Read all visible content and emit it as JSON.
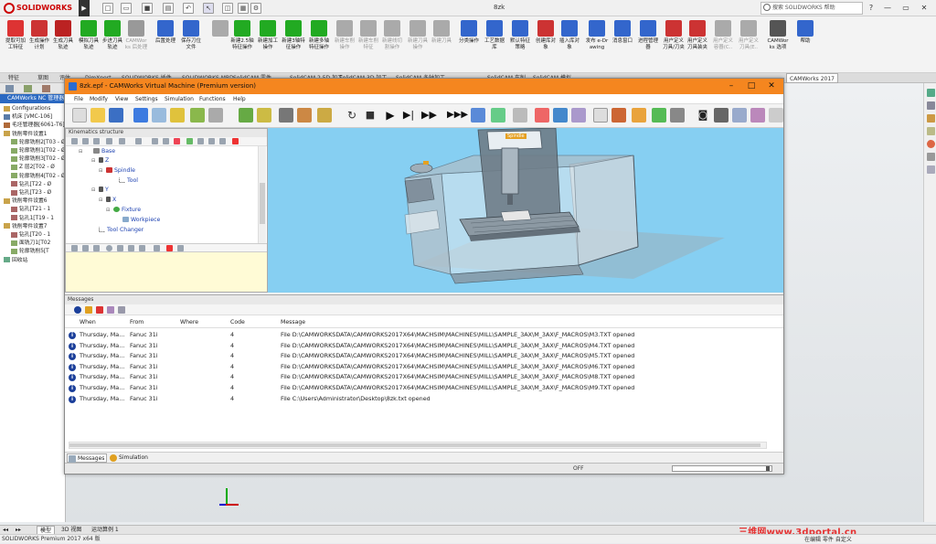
{
  "sw": {
    "logo": "SOLIDWORKS",
    "doc_name": "8zk",
    "search_placeholder": "搜索 SOLIDWORKS 帮助",
    "window_buttons": [
      "?",
      "—",
      "▭",
      "✕"
    ],
    "command_items": [
      {
        "label": "提取可加工特征",
        "color": "#d33"
      },
      {
        "label": "生成操作计划",
        "color": "#c33"
      },
      {
        "label": "生成刀具轨迹",
        "color": "#b22"
      },
      {
        "label": "模拟刀具轨迹",
        "color": "#2a2"
      },
      {
        "label": "步进刀具轨迹",
        "color": "#2a2"
      },
      {
        "label": "CAMWorks 后处理",
        "color": "#999",
        "disabled": true
      },
      {
        "label": "后置处理",
        "color": "#36c"
      },
      {
        "label": "保存刀位文件",
        "color": "#36c"
      },
      {
        "label": "",
        "color": "#aaa",
        "disabled": true
      },
      {
        "label": "新建2.5轴特征操作",
        "color": "#2a2"
      },
      {
        "label": "新建加工操作",
        "color": "#2a2"
      },
      {
        "label": "新建3轴特征操作",
        "color": "#2a2"
      },
      {
        "label": "新建多轴特征操作",
        "color": "#2a2"
      },
      {
        "label": "新建车削操作",
        "color": "#aaa",
        "disabled": true
      },
      {
        "label": "新建车削特征",
        "color": "#aaa",
        "disabled": true
      },
      {
        "label": "新建线切割操作",
        "color": "#aaa",
        "disabled": true
      },
      {
        "label": "新建刀具操作",
        "color": "#aaa",
        "disabled": true
      },
      {
        "label": "新建刀具",
        "color": "#aaa",
        "disabled": true
      },
      {
        "label": "分类操作",
        "color": "#36c"
      },
      {
        "label": "工艺数据库",
        "color": "#36c"
      },
      {
        "label": "默认特征策略",
        "color": "#36c"
      },
      {
        "label": "创建库对象",
        "color": "#c33"
      },
      {
        "label": "插入库对象",
        "color": "#36c"
      },
      {
        "label": "发布 e-Drawing",
        "color": "#36c"
      },
      {
        "label": "消息窗口",
        "color": "#36c"
      },
      {
        "label": "进程管理器",
        "color": "#36c"
      },
      {
        "label": "用户定义刀具/刀夹",
        "color": "#c33"
      },
      {
        "label": "用户定义刀具装夹",
        "color": "#c33"
      },
      {
        "label": "用户定义容器(C..",
        "color": "#aaa",
        "disabled": true
      },
      {
        "label": "用户定义刀具(E..",
        "color": "#aaa",
        "disabled": true
      },
      {
        "label": "CAMWorks 选项",
        "color": "#555"
      },
      {
        "label": "帮助",
        "color": "#36c"
      }
    ],
    "tabs": [
      "特征",
      "草图",
      "评估",
      "DimXpert",
      "SOLIDWORKS 插件",
      "SOLIDWORKS MBD",
      "SolidCAM 零件",
      "SolidCAM 2.5D 加工",
      "SolidCAM 3D 加工",
      "SolidCAM 多轴加工",
      "SolidCAM 车削",
      "SolidCAM 模拟",
      "CAMWorks 2017"
    ],
    "left_head": "CAMWorks NC 管理器",
    "tree": [
      "Configurations",
      "机床 [VMC-106]",
      "毛坯管理器[6061-T6]",
      "铣削零件设置1",
      "轮廓铣削2[T03 - Ø",
      "轮廓铣削1[T02 - Ø",
      "轮廓铣削3[T02 - Ø",
      "Z 层2[T02 - Ø",
      "轮廓铣削4[T02 - Ø",
      "钻孔[T22 - Ø",
      "钻孔[T23 - Ø",
      "铣削零件设置6",
      "钻孔[T21 - 1",
      "钻孔1[T19 - 1",
      "铣削零件设置7",
      "钻孔[T20 - 1",
      "面铣刀1[T02",
      "轮廓铣削5[T",
      "回收站"
    ],
    "bottom_tabs": [
      "模型",
      "3D 视图",
      "运动算例 1"
    ],
    "status": "SOLIDWORKS Premium 2017 x64 版",
    "status_right": "在编辑 零件        自定义",
    "watermark": "三维网www.3dportal.cn"
  },
  "vm": {
    "title": "8zk.epf - CAMWorks Virtual Machine (Premium version)",
    "menu": [
      "File",
      "Modify",
      "View",
      "Settings",
      "Simulation",
      "Functions",
      "Help"
    ],
    "kinematics_title": "Kinematics structure",
    "nodes": {
      "base": "Base",
      "z": "Z",
      "spindle": "Spindle",
      "tool": "Tool",
      "y": "Y",
      "x": "X",
      "fixture": "Fixture",
      "workpiece": "Workpiece",
      "tool_changer": "Tool Changer"
    },
    "messages_title": "Messages",
    "columns": {
      "when": "When",
      "from": "From",
      "where": "Where",
      "code": "Code",
      "message": "Message"
    },
    "rows": [
      {
        "when": "Thursday, Ma...",
        "from": "Fanuc 31i",
        "where": "",
        "code": "4",
        "message": "File D:\\CAMWORKSDATA\\CAMWORKS2017X64\\MACHSIM\\MACHINES\\MILL\\SAMPLE_3AX\\M_3AX\\F_MACROS\\M3.TXT opened"
      },
      {
        "when": "Thursday, Ma...",
        "from": "Fanuc 31i",
        "where": "",
        "code": "4",
        "message": "File D:\\CAMWORKSDATA\\CAMWORKS2017X64\\MACHSIM\\MACHINES\\MILL\\SAMPLE_3AX\\M_3AX\\F_MACROS\\M4.TXT opened"
      },
      {
        "when": "Thursday, Ma...",
        "from": "Fanuc 31i",
        "where": "",
        "code": "4",
        "message": "File D:\\CAMWORKSDATA\\CAMWORKS2017X64\\MACHSIM\\MACHINES\\MILL\\SAMPLE_3AX\\M_3AX\\F_MACROS\\M5.TXT opened"
      },
      {
        "when": "Thursday, Ma...",
        "from": "Fanuc 31i",
        "where": "",
        "code": "4",
        "message": "File D:\\CAMWORKSDATA\\CAMWORKS2017X64\\MACHSIM\\MACHINES\\MILL\\SAMPLE_3AX\\M_3AX\\F_MACROS\\M6.TXT opened"
      },
      {
        "when": "Thursday, Ma...",
        "from": "Fanuc 31i",
        "where": "",
        "code": "4",
        "message": "File D:\\CAMWORKSDATA\\CAMWORKS2017X64\\MACHSIM\\MACHINES\\MILL\\SAMPLE_3AX\\M_3AX\\F_MACROS\\M8.TXT opened"
      },
      {
        "when": "Thursday, Ma...",
        "from": "Fanuc 31i",
        "where": "",
        "code": "4",
        "message": "File D:\\CAMWORKSDATA\\CAMWORKS2017X64\\MACHSIM\\MACHINES\\MILL\\SAMPLE_3AX\\M_3AX\\F_MACROS\\M9.TXT opened"
      },
      {
        "when": "Thursday, Ma...",
        "from": "Fanuc 31i",
        "where": "",
        "code": "4",
        "message": "File C:\\Users\\Administrator\\Desktop\\8zk.txt opened"
      }
    ],
    "tabs": {
      "messages": "Messages",
      "history": "Simulation history"
    },
    "status_off": "OFF",
    "machine_label": "Spindle"
  }
}
